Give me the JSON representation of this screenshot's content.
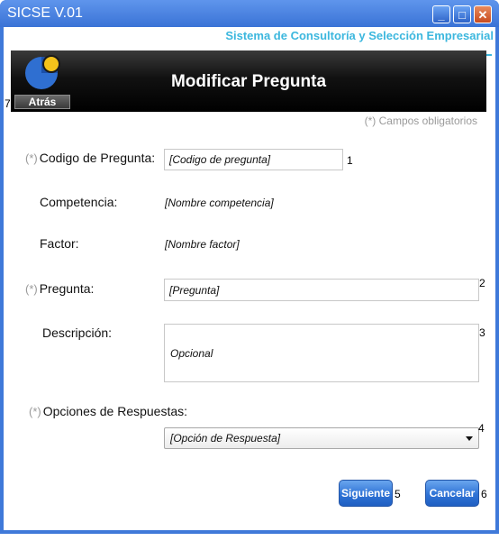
{
  "window": {
    "title": "SICSE V.01",
    "minimize_label": "_",
    "maximize_label": "□",
    "close_label": "✕"
  },
  "header": {
    "subtitle": "Sistema de Consultoría y Selección Empresarial",
    "title": "Modificar Pregunta",
    "back_label": "Atrás",
    "logo_icon": "logo-icon",
    "colors": {
      "subtitle": "#3cb7de",
      "logo_blue": "#2f6fd1",
      "logo_yellow": "#f3c21b"
    }
  },
  "required_note": "(*) Campos obligatorios",
  "required_mark": "(*)",
  "form": {
    "codigo": {
      "label": "Codigo de Pregunta:",
      "value": "[Codigo de pregunta]",
      "marker": "1"
    },
    "competencia": {
      "label": "Competencia:",
      "value": "[Nombre competencia]"
    },
    "factor": {
      "label": "Factor:",
      "value": "[Nombre factor]"
    },
    "pregunta": {
      "label": "Pregunta:",
      "value": "[Pregunta]",
      "marker": "2"
    },
    "descripcion": {
      "label": "Descripción:",
      "value": "Opcional",
      "marker": "3"
    },
    "opciones": {
      "label": "Opciones de Respuestas:",
      "selected": "[Opción de Respuesta]",
      "marker": "4"
    }
  },
  "buttons": {
    "siguiente": {
      "label": "Siguiente",
      "marker": "5"
    },
    "cancelar": {
      "label": "Cancelar",
      "marker": "6"
    },
    "back_marker": "7"
  }
}
